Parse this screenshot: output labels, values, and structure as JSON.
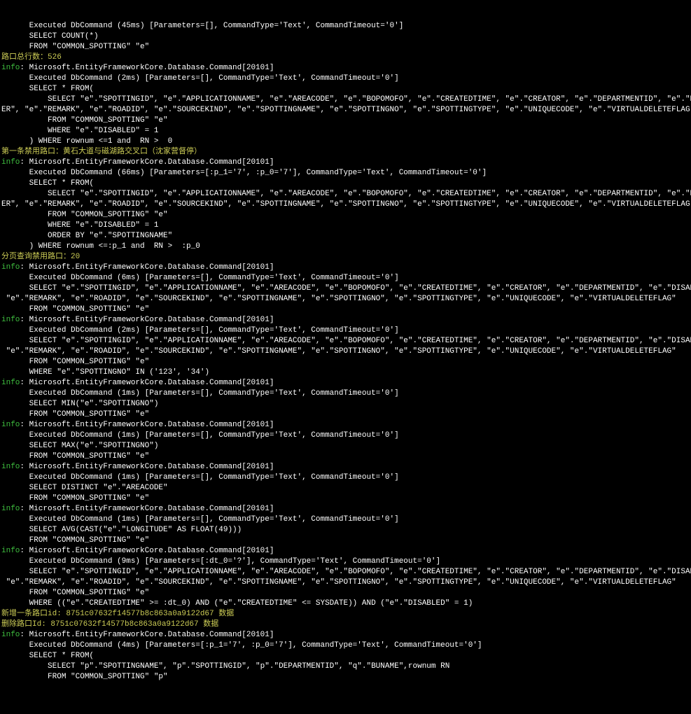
{
  "lines": [
    [
      "w",
      "      Executed DbCommand (45ms) [Parameters=[], CommandType='Text', CommandTimeout='0']"
    ],
    [
      "w",
      "      SELECT COUNT(*)"
    ],
    [
      "w",
      "      FROM \"COMMON_SPOTTING\" \"e\""
    ],
    [
      "y",
      "路口总行数：526"
    ],
    [
      "m",
      ": Microsoft.EntityFrameworkCore.Database.Command[20101]"
    ],
    [
      "w",
      "      Executed DbCommand (2ms) [Parameters=[], CommandType='Text', CommandTimeout='0']"
    ],
    [
      "w",
      "      SELECT * FROM("
    ],
    [
      "w",
      "          SELECT \"e\".\"SPOTTINGID\", \"e\".\"APPLICATIONNAME\", \"e\".\"AREACODE\", \"e\".\"BOPOMOFO\", \"e\".\"CREATEDTIME\", \"e\".\"CREATOR\", \"e\".\"DEPARTMENTID\", \"e\".\"DISABLED\", \"e\".\"FLAGS\", \"e\".\"LATITUDE\", \"e\".\"LONGITUDE\", \"e\".\"MODIFI"
    ],
    [
      "w",
      "ER\", \"e\".\"REMARK\", \"e\".\"ROADID\", \"e\".\"SOURCEKIND\", \"e\".\"SPOTTINGNAME\", \"e\".\"SPOTTINGNO\", \"e\".\"SPOTTINGTYPE\", \"e\".\"UNIQUECODE\", \"e\".\"VIRTUALDELETEFLAG\",rownum RN"
    ],
    [
      "w",
      "          FROM \"COMMON_SPOTTING\" \"e\""
    ],
    [
      "w",
      "          WHERE \"e\".\"DISABLED\" = 1"
    ],
    [
      "w",
      "      ) WHERE rownum <=1 and  RN >  0"
    ],
    [
      "y",
      "第一条禁用路口：黄石大道与磁湖路交叉口（沈家营督停）"
    ],
    [
      "m",
      ": Microsoft.EntityFrameworkCore.Database.Command[20101]"
    ],
    [
      "w",
      "      Executed DbCommand (66ms) [Parameters=[:p_1='7', :p_0='7'], CommandType='Text', CommandTimeout='0']"
    ],
    [
      "w",
      "      SELECT * FROM("
    ],
    [
      "w",
      "          SELECT \"e\".\"SPOTTINGID\", \"e\".\"APPLICATIONNAME\", \"e\".\"AREACODE\", \"e\".\"BOPOMOFO\", \"e\".\"CREATEDTIME\", \"e\".\"CREATOR\", \"e\".\"DEPARTMENTID\", \"e\".\"DISABLED\", \"e\".\"FLAGS\", \"e\".\"LATITUDE\", \"e\".\"LONGITUDE\", \"e\".\"MODIFI"
    ],
    [
      "w",
      "ER\", \"e\".\"REMARK\", \"e\".\"ROADID\", \"e\".\"SOURCEKIND\", \"e\".\"SPOTTINGNAME\", \"e\".\"SPOTTINGNO\", \"e\".\"SPOTTINGTYPE\", \"e\".\"UNIQUECODE\", \"e\".\"VIRTUALDELETEFLAG\",rownum RN"
    ],
    [
      "w",
      "          FROM \"COMMON_SPOTTING\" \"e\""
    ],
    [
      "w",
      "          WHERE \"e\".\"DISABLED\" = 1"
    ],
    [
      "w",
      "          ORDER BY \"e\".\"SPOTTINGNAME\""
    ],
    [
      "w",
      "      ) WHERE rownum <=:p_1 and  RN >  :p_0"
    ],
    [
      "y",
      "分页查询禁用路口：20"
    ],
    [
      "m",
      ": Microsoft.EntityFrameworkCore.Database.Command[20101]"
    ],
    [
      "w",
      "      Executed DbCommand (6ms) [Parameters=[], CommandType='Text', CommandTimeout='0']"
    ],
    [
      "w",
      "      SELECT \"e\".\"SPOTTINGID\", \"e\".\"APPLICATIONNAME\", \"e\".\"AREACODE\", \"e\".\"BOPOMOFO\", \"e\".\"CREATEDTIME\", \"e\".\"CREATOR\", \"e\".\"DEPARTMENTID\", \"e\".\"DISABLED\", \"e\".\"FLAGS\", \"e\".\"LATITUDE\", \"e\".\"LONGITUDE\", \"e\".\"MODIFIER\","
    ],
    [
      "w",
      " \"e\".\"REMARK\", \"e\".\"ROADID\", \"e\".\"SOURCEKIND\", \"e\".\"SPOTTINGNAME\", \"e\".\"SPOTTINGNO\", \"e\".\"SPOTTINGTYPE\", \"e\".\"UNIQUECODE\", \"e\".\"VIRTUALDELETEFLAG\""
    ],
    [
      "w",
      "      FROM \"COMMON_SPOTTING\" \"e\""
    ],
    [
      "m",
      ": Microsoft.EntityFrameworkCore.Database.Command[20101]"
    ],
    [
      "w",
      "      Executed DbCommand (2ms) [Parameters=[], CommandType='Text', CommandTimeout='0']"
    ],
    [
      "w",
      "      SELECT \"e\".\"SPOTTINGID\", \"e\".\"APPLICATIONNAME\", \"e\".\"AREACODE\", \"e\".\"BOPOMOFO\", \"e\".\"CREATEDTIME\", \"e\".\"CREATOR\", \"e\".\"DEPARTMENTID\", \"e\".\"DISABLED\", \"e\".\"FLAGS\", \"e\".\"LATITUDE\", \"e\".\"LONGITUDE\", \"e\".\"MODIFIER\","
    ],
    [
      "w",
      " \"e\".\"REMARK\", \"e\".\"ROADID\", \"e\".\"SOURCEKIND\", \"e\".\"SPOTTINGNAME\", \"e\".\"SPOTTINGNO\", \"e\".\"SPOTTINGTYPE\", \"e\".\"UNIQUECODE\", \"e\".\"VIRTUALDELETEFLAG\""
    ],
    [
      "w",
      "      FROM \"COMMON_SPOTTING\" \"e\""
    ],
    [
      "w",
      "      WHERE \"e\".\"SPOTTINGNO\" IN ('123', '34')"
    ],
    [
      "m",
      ": Microsoft.EntityFrameworkCore.Database.Command[20101]"
    ],
    [
      "w",
      "      Executed DbCommand (1ms) [Parameters=[], CommandType='Text', CommandTimeout='0']"
    ],
    [
      "w",
      "      SELECT MIN(\"e\".\"SPOTTINGNO\")"
    ],
    [
      "w",
      "      FROM \"COMMON_SPOTTING\" \"e\""
    ],
    [
      "m",
      ": Microsoft.EntityFrameworkCore.Database.Command[20101]"
    ],
    [
      "w",
      "      Executed DbCommand (1ms) [Parameters=[], CommandType='Text', CommandTimeout='0']"
    ],
    [
      "w",
      "      SELECT MAX(\"e\".\"SPOTTINGNO\")"
    ],
    [
      "w",
      "      FROM \"COMMON_SPOTTING\" \"e\""
    ],
    [
      "m",
      ": Microsoft.EntityFrameworkCore.Database.Command[20101]"
    ],
    [
      "w",
      "      Executed DbCommand (1ms) [Parameters=[], CommandType='Text', CommandTimeout='0']"
    ],
    [
      "w",
      "      SELECT DISTINCT \"e\".\"AREACODE\""
    ],
    [
      "w",
      "      FROM \"COMMON_SPOTTING\" \"e\""
    ],
    [
      "m",
      ": Microsoft.EntityFrameworkCore.Database.Command[20101]"
    ],
    [
      "w",
      "      Executed DbCommand (1ms) [Parameters=[], CommandType='Text', CommandTimeout='0']"
    ],
    [
      "w",
      "      SELECT AVG(CAST(\"e\".\"LONGITUDE\" AS FLOAT(49)))"
    ],
    [
      "w",
      "      FROM \"COMMON_SPOTTING\" \"e\""
    ],
    [
      "m",
      ": Microsoft.EntityFrameworkCore.Database.Command[20101]"
    ],
    [
      "w",
      "      Executed DbCommand (9ms) [Parameters=[:dt_0='?'], CommandType='Text', CommandTimeout='0']"
    ],
    [
      "w",
      "      SELECT \"e\".\"SPOTTINGID\", \"e\".\"APPLICATIONNAME\", \"e\".\"AREACODE\", \"e\".\"BOPOMOFO\", \"e\".\"CREATEDTIME\", \"e\".\"CREATOR\", \"e\".\"DEPARTMENTID\", \"e\".\"DISABLED\", \"e\".\"FLAGS\", \"e\".\"LATITUDE\", \"e\".\"LONGITUDE\", \"e\".\"MODIFIER\","
    ],
    [
      "w",
      " \"e\".\"REMARK\", \"e\".\"ROADID\", \"e\".\"SOURCEKIND\", \"e\".\"SPOTTINGNAME\", \"e\".\"SPOTTINGNO\", \"e\".\"SPOTTINGTYPE\", \"e\".\"UNIQUECODE\", \"e\".\"VIRTUALDELETEFLAG\""
    ],
    [
      "w",
      "      FROM \"COMMON_SPOTTING\" \"e\""
    ],
    [
      "w",
      "      WHERE ((\"e\".\"CREATEDTIME\" >= :dt_0) AND (\"e\".\"CREATEDTIME\" <= SYSDATE)) AND (\"e\".\"DISABLED\" = 1)"
    ],
    [
      "y",
      "新增一条路口id: 8751c07632f14577b8c863a0a9122d67 数据"
    ],
    [
      "y",
      "删除路口Id: 8751c07632f14577b8c863a0a9122d67 数据"
    ],
    [
      "m",
      ": Microsoft.EntityFrameworkCore.Database.Command[20101]"
    ],
    [
      "w",
      "      Executed DbCommand (4ms) [Parameters=[:p_1='7', :p_0='7'], CommandType='Text', CommandTimeout='0']"
    ],
    [
      "w",
      "      SELECT * FROM("
    ],
    [
      "w",
      "          SELECT \"p\".\"SPOTTINGNAME\", \"p\".\"SPOTTINGID\", \"p\".\"DEPARTMENTID\", \"q\".\"BUNAME\",rownum RN"
    ],
    [
      "w",
      "          FROM \"COMMON_SPOTTING\" \"p\""
    ]
  ],
  "infoLabel": "info"
}
